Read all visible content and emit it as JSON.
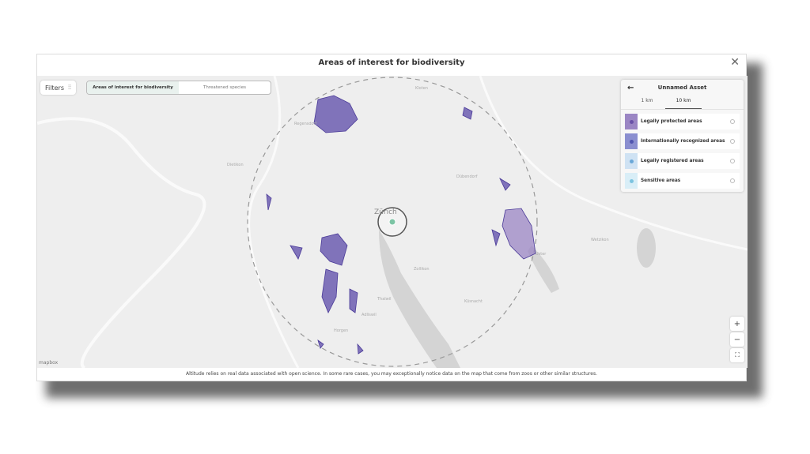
{
  "modal": {
    "title": "Areas of interest for biodiversity",
    "close_icon": "close-icon"
  },
  "toolbar": {
    "filters_label": "Filters",
    "tabs": [
      {
        "label": "Areas of interest for biodiversity",
        "active": true
      },
      {
        "label": "Threatened species",
        "active": false
      }
    ]
  },
  "panel": {
    "title": "Unnamed Asset",
    "radius_tabs": [
      {
        "label": "1 km",
        "active": false
      },
      {
        "label": "10 km",
        "active": true
      }
    ],
    "layers": [
      {
        "label": "Legally protected areas",
        "color": "#9b86c4",
        "dot": "#6a52a8"
      },
      {
        "label": "Internationally recognized areas",
        "color": "#8b8fd0",
        "dot": "#5055b0"
      },
      {
        "label": "Legally registered areas",
        "color": "#cfe2f3",
        "dot": "#6aa8d8"
      },
      {
        "label": "Sensitive areas",
        "color": "#d9eef7",
        "dot": "#7cc4e0"
      }
    ]
  },
  "map": {
    "center_label": "Zürich",
    "attribution": "mapbox",
    "zoom_in": "+",
    "zoom_out": "−",
    "fit": "⛶",
    "places": [
      "Kloten",
      "Dübendorf",
      "Uster",
      "Zollikon",
      "Küsnacht",
      "Horgen",
      "Adliswil",
      "Thalwil",
      "Wetzikon",
      "Dietikon",
      "Regensdorf"
    ],
    "area_color": "#5b4aa8"
  },
  "footer": {
    "note": "Altitude relies on real data associated with open science. In some rare cases, you may exceptionally notice data on the map that come from zoos or other similar structures."
  }
}
